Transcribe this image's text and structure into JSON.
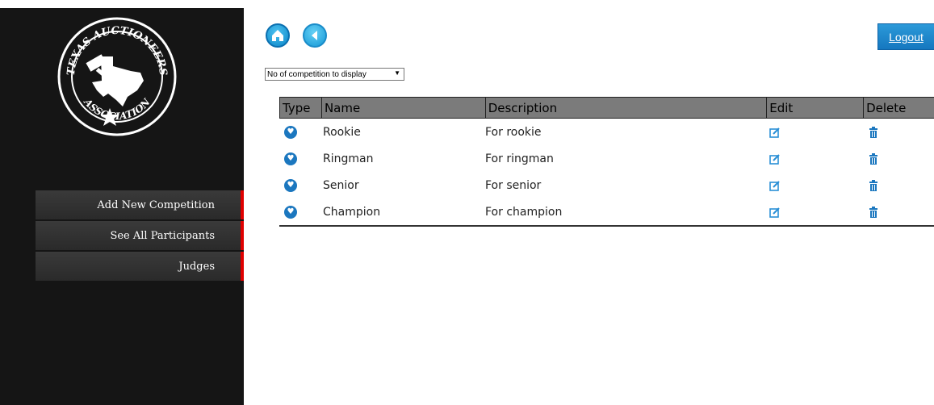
{
  "sidebar": {
    "logo_text_top": "TEXAS AUCTIONEERS",
    "logo_text_bottom": "ASSOCIATION",
    "menu": [
      {
        "label": "Add New Competition"
      },
      {
        "label": "See All Participants"
      },
      {
        "label": "Judges"
      }
    ]
  },
  "header": {
    "logout_label": "Logout",
    "display_select": "No of competition to display"
  },
  "table": {
    "columns": [
      "Type",
      "Name",
      "Description",
      "Edit",
      "Delete"
    ],
    "rows": [
      {
        "name": "Rookie",
        "description": "For rookie"
      },
      {
        "name": "Ringman",
        "description": "For ringman"
      },
      {
        "name": "Senior",
        "description": "For senior"
      },
      {
        "name": "Champion",
        "description": "For champion"
      }
    ]
  },
  "icons": {
    "home": "home-icon",
    "back": "back-arrow-icon",
    "type": "trophy-icon",
    "edit": "edit-icon",
    "delete": "trash-icon"
  },
  "colors": {
    "sidebar_bg": "#151515",
    "menu_accent": "#e00000",
    "primary_blue": "#1577bf",
    "table_header_bg": "#7b7b7b"
  }
}
